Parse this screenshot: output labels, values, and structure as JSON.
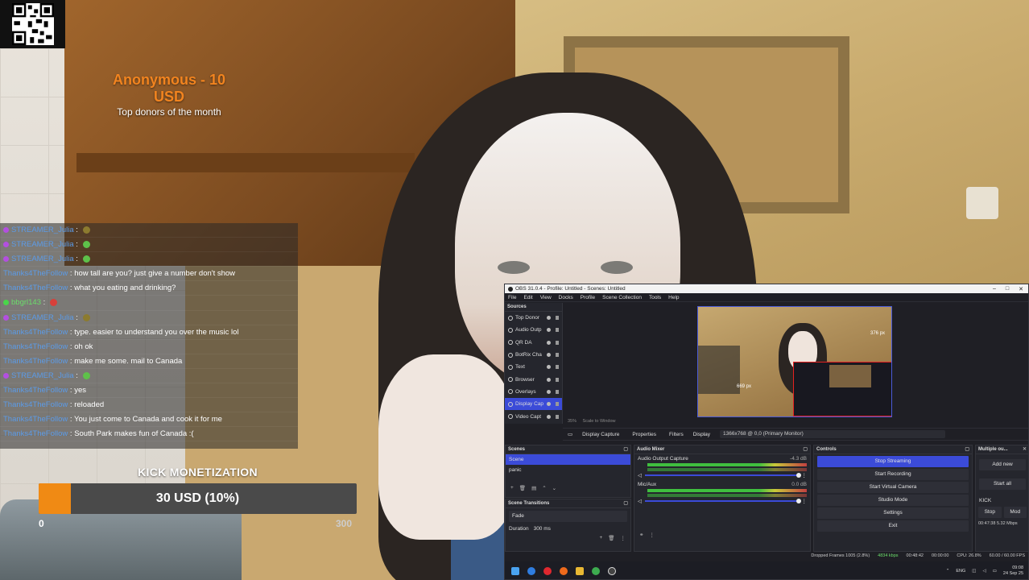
{
  "donor": {
    "name": "Anonymous - 10 USD",
    "subtitle": "Top donors of the month"
  },
  "chat": {
    "messages": [
      {
        "user": "STREAMER_Julia",
        "text": "",
        "emote": "mix",
        "badge": "purple"
      },
      {
        "user": "STREAMER_Julia",
        "text": "",
        "emote": "green",
        "badge": "purple"
      },
      {
        "user": "STREAMER_Julia",
        "text": "",
        "emote": "green",
        "badge": "purple"
      },
      {
        "user": "Thanks4TheFollow",
        "text": "how tall are you? just give a number don't show"
      },
      {
        "user": "Thanks4TheFollow",
        "text": "what you eating and drinking?"
      },
      {
        "user": "bbgrl143",
        "text": "",
        "emote": "red",
        "badge": "green"
      },
      {
        "user": "STREAMER_Julia",
        "text": "",
        "emote": "mix",
        "badge": "purple"
      },
      {
        "user": "Thanks4TheFollow",
        "text": "type. easier to understand you over the music lol"
      },
      {
        "user": "Thanks4TheFollow",
        "text": "oh ok"
      },
      {
        "user": "Thanks4TheFollow",
        "text": "make me some. mail to Canada"
      },
      {
        "user": "STREAMER_Julia",
        "text": "",
        "emote": "green",
        "badge": "purple"
      },
      {
        "user": "Thanks4TheFollow",
        "text": "yes"
      },
      {
        "user": "Thanks4TheFollow",
        "text": "reloaded"
      },
      {
        "user": "Thanks4TheFollow",
        "text": "You just come to Canada and cook it for me"
      },
      {
        "user": "Thanks4TheFollow",
        "text": "South Park makes fun of Canada :("
      }
    ]
  },
  "kick": {
    "title": "KICK MONETIZATION",
    "amount_text": "30 USD (10%)",
    "progress": 0.1,
    "min_label": "0",
    "max_label": "300",
    "fill_color": "#f08a14"
  },
  "obs": {
    "title": "OBS 31.0.4 - Profile: Untitled - Scenes: Untitled",
    "menu": [
      "File",
      "Edit",
      "View",
      "Docks",
      "Profile",
      "Scene Collection",
      "Tools",
      "Help"
    ],
    "sources_header": "Sources",
    "sources": [
      "Top Donor",
      "Audio Outp",
      "QR DA",
      "BotRix Cha",
      "Text",
      "Browser",
      "Overlays",
      "Display Cap",
      "Video Capt"
    ],
    "active_source_index": 7,
    "preview": {
      "label_a": "376 px",
      "label_b": "669 px"
    },
    "zoom": "35%",
    "scale": "Scale to Window",
    "toolbar": {
      "source_name": "Display Capture",
      "properties": "Properties",
      "filters": "Filters",
      "display_label": "Display",
      "display_value": "1366x768 @ 0,0 (Primary Monitor)"
    },
    "scenes_header": "Scenes",
    "scenes": [
      "Scene",
      "panic"
    ],
    "transitions_header": "Scene Transitions",
    "transition": "Fade",
    "duration_label": "Duration",
    "duration": "300 ms",
    "mixer_header": "Audio Mixer",
    "mixer": [
      {
        "name": "Audio Output Capture",
        "db": "-4.3 dB"
      },
      {
        "name": "Mic/Aux",
        "db": "0.0 dB"
      }
    ],
    "controls_header": "Controls",
    "controls": [
      "Stop Streaming",
      "Start Recording",
      "Start Virtual Camera",
      "Studio Mode",
      "Settings",
      "Exit"
    ],
    "multi_header": "Multiple ou...",
    "multi": {
      "add_new": "Add new",
      "start_all": "Start all",
      "platform": "KICK",
      "stop": "Stop",
      "modify": "Mod",
      "time": "00:47:38",
      "bitrate": "5.32 Mbps"
    },
    "status": {
      "dropped": "Dropped Frames 1005 (2.8%)",
      "kbps": "4834 kbps",
      "stream_time": "00:48:42",
      "rec_time": "00:00:00",
      "cpu": "CPU: 26.8%",
      "fps": "60.00 / 60.00 FPS"
    },
    "taskbar": {
      "lang": "ENG",
      "time": "09:08",
      "date": "24 Sep 25"
    }
  }
}
